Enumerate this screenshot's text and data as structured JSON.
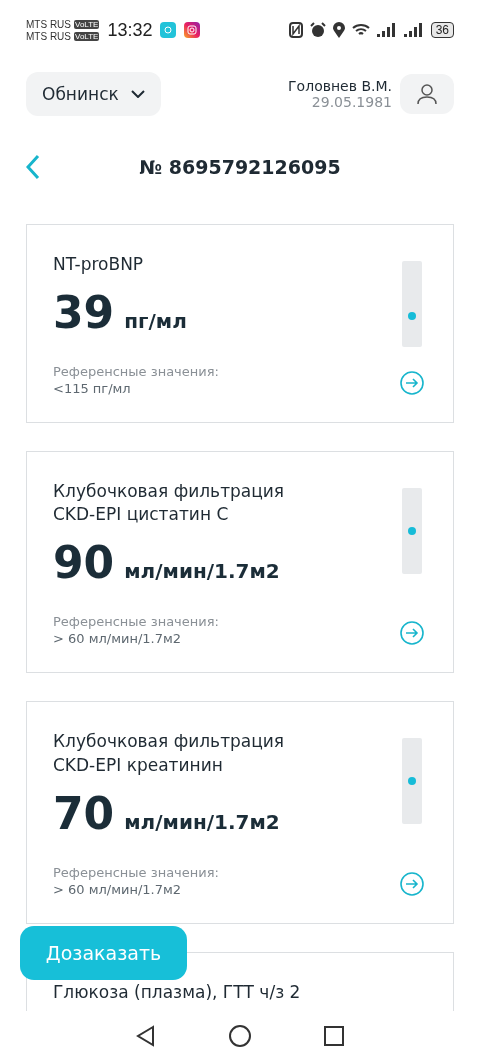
{
  "status_bar": {
    "carriers": [
      {
        "name": "MTS RUS",
        "badge": "VoLTE"
      },
      {
        "name": "MTS RUS",
        "badge": "VoLTE"
      }
    ],
    "time": "13:32",
    "battery": "36"
  },
  "header": {
    "city": "Обнинск",
    "patient_name": "Головнев В.М.",
    "patient_birthdate": "29.05.1981"
  },
  "order": {
    "title": "№ 8695792126095"
  },
  "results": [
    {
      "name": "NT-proBNP",
      "value": "39",
      "unit": "пг/мл",
      "reference_label": "Референсные значения:",
      "reference_value": "<115 пг/мл",
      "level": 0.36
    },
    {
      "name": "Клубочковая фильтрация CKD-EPI цистатин С",
      "value": "90",
      "unit": "мл/мин/1.7м2",
      "reference_label": "Референсные значения:",
      "reference_value": "> 60 мл/мин/1.7м2",
      "level": 0.5
    },
    {
      "name": "Клубочковая фильтрация CKD-EPI креатинин",
      "value": "70",
      "unit": "мл/мин/1.7м2",
      "reference_label": "Референсные значения:",
      "reference_value": "> 60 мл/мин/1.7м2",
      "level": 0.5
    },
    {
      "name": "Глюкоза (плазма), ГТТ ч/з 2"
    }
  ],
  "order_more_button": "Дозаказать"
}
